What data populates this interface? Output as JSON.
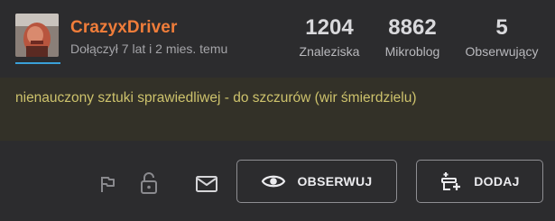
{
  "profile": {
    "username": "CrazyxDriver",
    "joined": "Dołączył 7 lat i 2 mies. temu",
    "avatar_icon": "user-avatar-photo"
  },
  "stats": [
    {
      "value": "1204",
      "label": "Znaleziska"
    },
    {
      "value": "8862",
      "label": "Mikroblog"
    },
    {
      "value": "5",
      "label": "Obserwujący"
    }
  ],
  "description": "nienauczony sztuki sprawiedliwej - do szczurów (wir śmierdzielu)",
  "actions": {
    "report_icon": "flag-icon",
    "block_icon": "unlock-icon",
    "message_icon": "envelope-icon",
    "observe_label": "OBSERWUJ",
    "observe_icon": "eye-icon",
    "add_label": "DODAJ",
    "add_icon": "add-plus-icon"
  },
  "colors": {
    "background": "#2c2c2e",
    "username": "#f07d3a",
    "description_text": "#cdc26c",
    "description_band": "#333128",
    "accent_underline": "#3aa0d8"
  }
}
